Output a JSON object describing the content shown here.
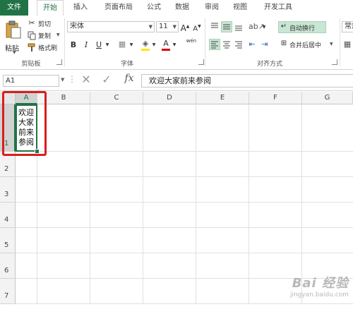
{
  "tabs": [
    {
      "label": "文件"
    },
    {
      "label": "开始"
    },
    {
      "label": "插入"
    },
    {
      "label": "页面布局"
    },
    {
      "label": "公式"
    },
    {
      "label": "数据"
    },
    {
      "label": "审阅"
    },
    {
      "label": "视图"
    },
    {
      "label": "开发工具"
    }
  ],
  "clipboard": {
    "paste_label": "粘贴",
    "cut_label": "剪切",
    "copy_label": "复制",
    "format_painter_label": "格式刷",
    "group_label": "剪贴板"
  },
  "font": {
    "font_name": "宋体",
    "font_size": "11",
    "bold": "B",
    "italic": "I",
    "underline": "U",
    "phonetic": "wén",
    "group_label": "字体"
  },
  "alignment": {
    "wrap_text_label": "自动换行",
    "merge_center_label": "合并后居中",
    "group_label": "对齐方式"
  },
  "number": {
    "format_label": "常规"
  },
  "formula_bar": {
    "name_box": "A1",
    "fx": "fx",
    "content": "欢迎大家前来参阅"
  },
  "grid": {
    "columns": [
      "A",
      "B",
      "C",
      "D",
      "E",
      "F",
      "G"
    ],
    "rows": [
      "1",
      "2",
      "3",
      "4",
      "5",
      "6",
      "7"
    ],
    "cell_A1": "欢迎大家前来参阅"
  },
  "watermark": {
    "line1": "Bai 经验",
    "line2": "jingyan.baidu.com"
  },
  "colors": {
    "accent": "#217346",
    "highlight_box": "#d91e1e"
  }
}
